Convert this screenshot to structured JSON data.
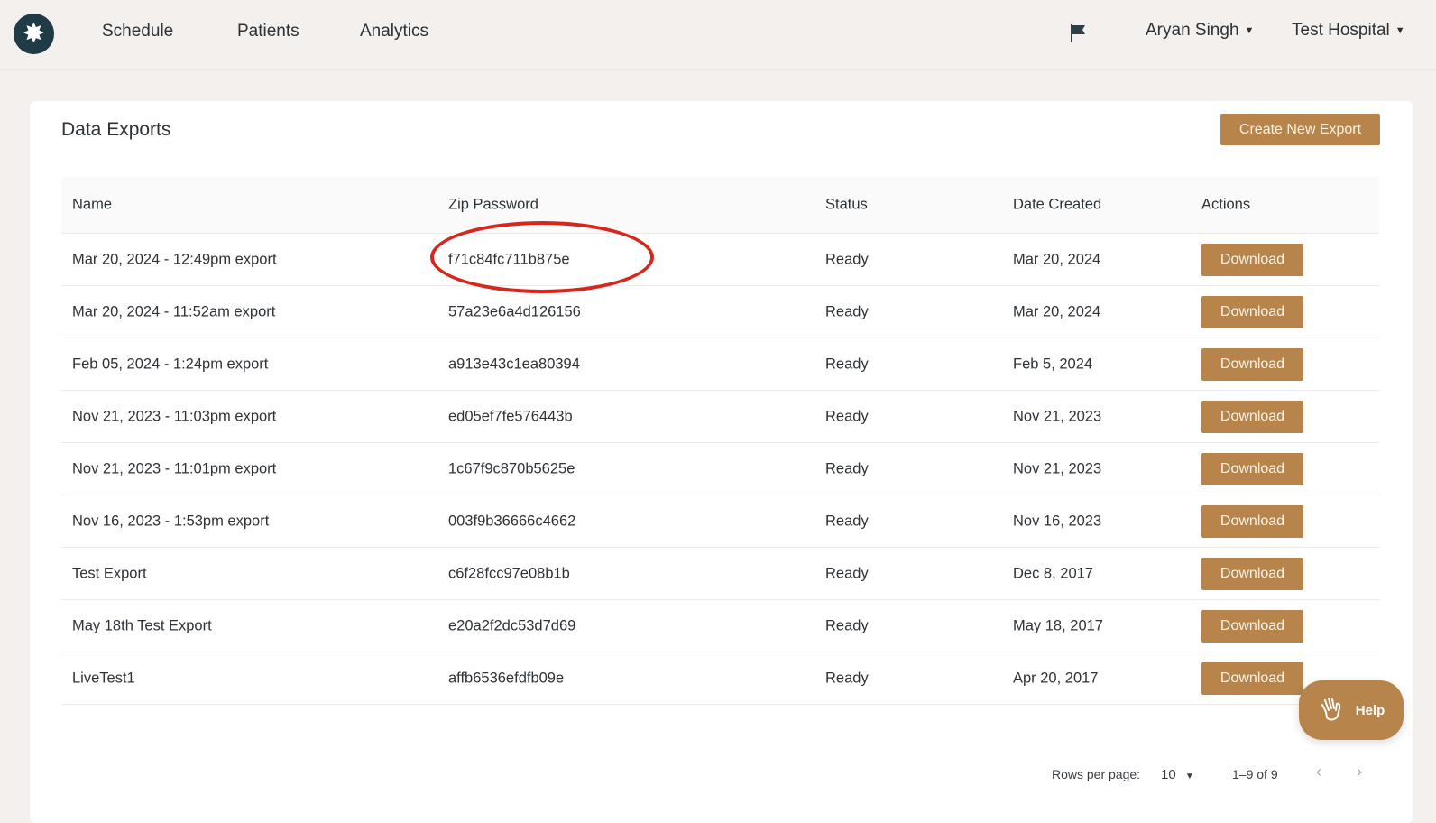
{
  "nav": {
    "links": [
      "Schedule",
      "Patients",
      "Analytics"
    ],
    "user": "Aryan Singh",
    "hospital": "Test Hospital"
  },
  "page": {
    "title": "Data Exports",
    "create_label": "Create New Export"
  },
  "table": {
    "headers": [
      "Name",
      "Zip Password",
      "Status",
      "Date Created",
      "Actions"
    ],
    "rows": [
      {
        "name": "Mar 20, 2024 - 12:49pm export",
        "password": "f71c84fc711b875e",
        "status": "Ready",
        "date": "Mar 20, 2024",
        "action": "Download"
      },
      {
        "name": "Mar 20, 2024 - 11:52am export",
        "password": "57a23e6a4d126156",
        "status": "Ready",
        "date": "Mar 20, 2024",
        "action": "Download"
      },
      {
        "name": "Feb 05, 2024 - 1:24pm export",
        "password": "a913e43c1ea80394",
        "status": "Ready",
        "date": "Feb 5, 2024",
        "action": "Download"
      },
      {
        "name": "Nov 21, 2023 - 11:03pm export",
        "password": "ed05ef7fe576443b",
        "status": "Ready",
        "date": "Nov 21, 2023",
        "action": "Download"
      },
      {
        "name": "Nov 21, 2023 - 11:01pm export",
        "password": "1c67f9c870b5625e",
        "status": "Ready",
        "date": "Nov 21, 2023",
        "action": "Download"
      },
      {
        "name": "Nov 16, 2023 - 1:53pm export",
        "password": "003f9b36666c4662",
        "status": "Ready",
        "date": "Nov 16, 2023",
        "action": "Download"
      },
      {
        "name": "Test Export",
        "password": "c6f28fcc97e08b1b",
        "status": "Ready",
        "date": "Dec 8, 2017",
        "action": "Download"
      },
      {
        "name": "May 18th Test Export",
        "password": "e20a2f2dc53d7d69",
        "status": "Ready",
        "date": "May 18, 2017",
        "action": "Download"
      },
      {
        "name": "LiveTest1",
        "password": "affb6536efdfb09e",
        "status": "Ready",
        "date": "Apr 20, 2017",
        "action": "Download"
      }
    ]
  },
  "pagination": {
    "rows_label": "Rows per page:",
    "rows_value": "10",
    "range": "1–9 of 9"
  },
  "help": {
    "label": "Help"
  },
  "colors": {
    "accent": "#b7844b",
    "highlight": "#d9261c",
    "logo": "#1f3b45"
  }
}
